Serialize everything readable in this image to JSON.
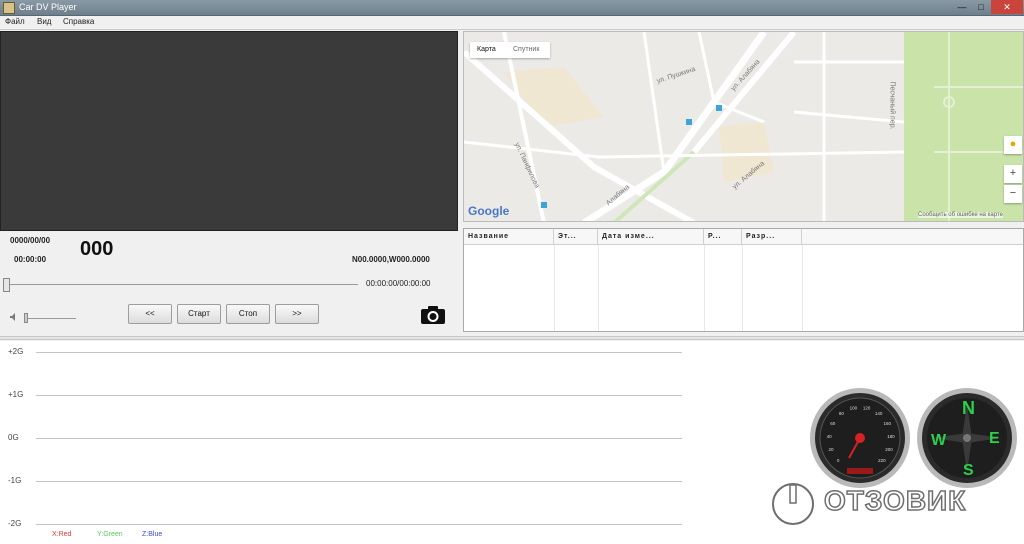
{
  "window": {
    "title": "Car DV Player",
    "minimize": "—",
    "maximize": "□",
    "close": "✕"
  },
  "menu": [
    "Файл",
    "Вид",
    "Справка"
  ],
  "info": {
    "date": "0000/00/00",
    "time": "00:00:00",
    "speed": "000",
    "coords": "N00.0000,W000.0000",
    "seek_time": "00:00:00/00:00:00"
  },
  "controls": {
    "rewind": "<<",
    "start": "Старт",
    "stop": "Стоп",
    "forward": ">>"
  },
  "icons": {
    "camera": "camera-icon",
    "volume": "volume-icon"
  },
  "map": {
    "tab_map": "Карта",
    "tab_satellite": "Спутник",
    "logo": "Google",
    "zoom_in": "+",
    "zoom_out": "−",
    "attribution": "Сообщить об ошибке на карте",
    "streets": [
      "ул. Пушкина",
      "ул. Алабяна",
      "ул. Панфилова",
      "Алабяна",
      "ул. Алабяна",
      "Песчаный пер."
    ]
  },
  "table": {
    "columns": [
      "Название",
      "Эт...",
      "Дата изме...",
      "Р...",
      "Разр..."
    ]
  },
  "gsensor": {
    "labels": [
      "+2G",
      "+1G",
      "0G",
      "-1G",
      "-2G"
    ],
    "legend": {
      "x": "X:Red",
      "y": "Y:Green",
      "z": "Z:Blue"
    },
    "colors": {
      "x": "#d93b3b",
      "y": "#59c95b",
      "z": "#3b4fd9"
    }
  },
  "speedometer": {
    "value": 0,
    "ticks": [
      "0",
      "20",
      "40",
      "60",
      "80",
      "100",
      "120",
      "140",
      "160",
      "180",
      "200",
      "220"
    ]
  },
  "compass": {
    "N": "N",
    "E": "E",
    "S": "S",
    "W": "W"
  },
  "watermark": "ОТЗОВИК"
}
